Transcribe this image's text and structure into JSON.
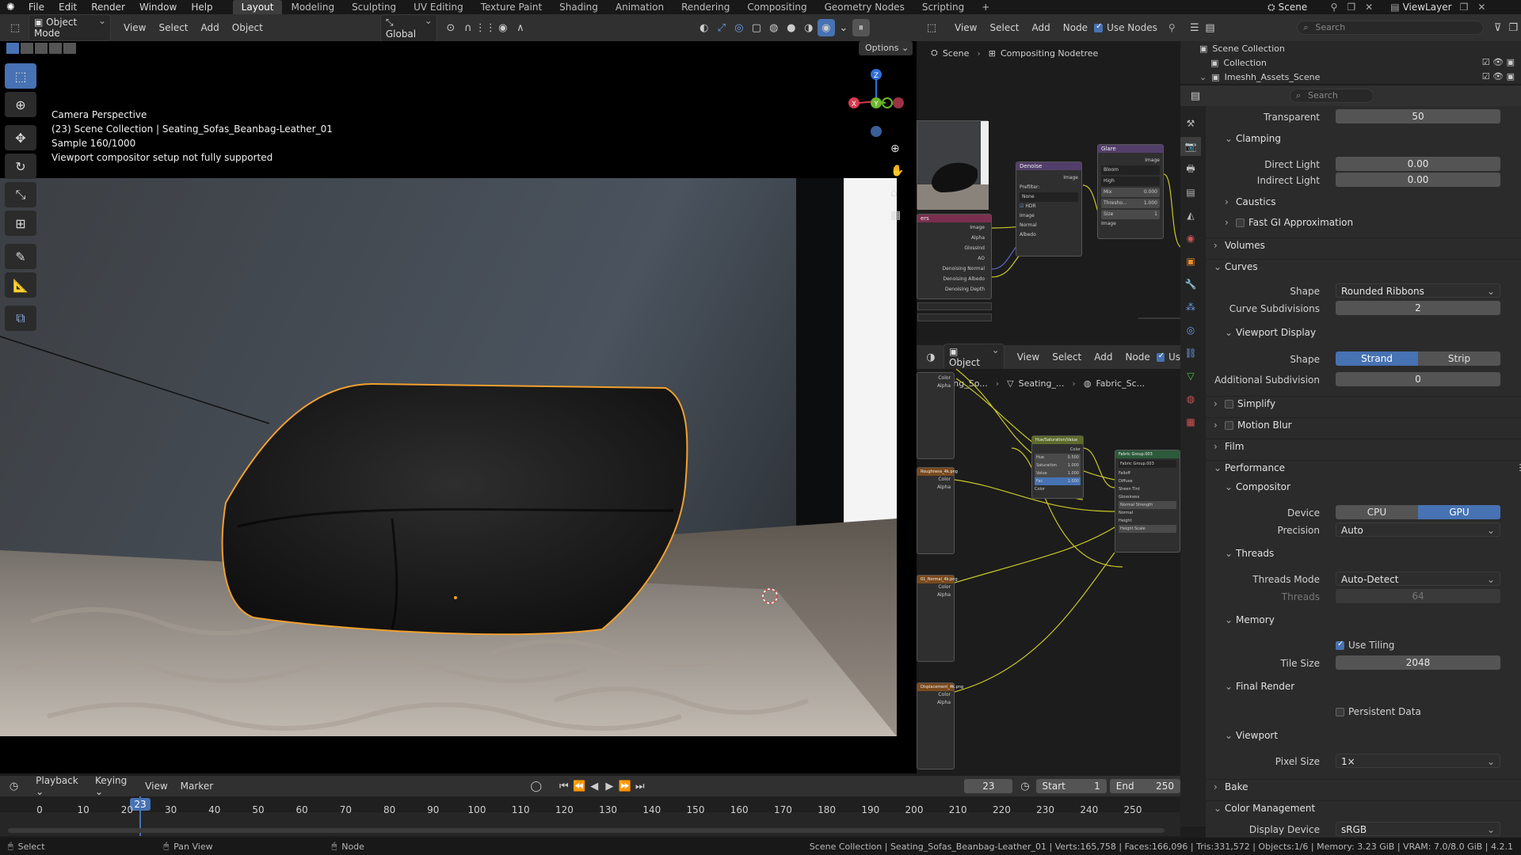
{
  "menu": [
    "File",
    "Edit",
    "Render",
    "Window",
    "Help"
  ],
  "workspaces": [
    "Layout",
    "Modeling",
    "Sculpting",
    "UV Editing",
    "Texture Paint",
    "Shading",
    "Animation",
    "Rendering",
    "Compositing",
    "Geometry Nodes",
    "Scripting"
  ],
  "active_workspace": "Layout",
  "scene_name": "Scene",
  "view_layer": "ViewLayer",
  "viewport": {
    "mode": "Object Mode",
    "menus": [
      "View",
      "Select",
      "Add",
      "Object"
    ],
    "transform_orientation": "Global",
    "options_label": "Options",
    "overlay_lines": [
      "Camera Perspective",
      "(23) Scene Collection | Seating_Sofas_Beanbag-Leather_01",
      "Sample 160/1000",
      "Viewport compositor setup not fully supported"
    ],
    "gizmo_axes": [
      "Z",
      "X",
      "Y"
    ]
  },
  "compositor": {
    "menus": [
      "View",
      "Select",
      "Add",
      "Node"
    ],
    "use_nodes_label": "Use Nodes",
    "breadcrumb": [
      "Scene",
      "Compositing Nodetree"
    ],
    "nodes": {
      "denoise": {
        "title": "Denoise",
        "output": "Image",
        "prefilter_label": "Prefilter:",
        "prefilter": "None",
        "hdr": "HDR",
        "inputs": [
          "Image",
          "Normal",
          "Albedo"
        ]
      },
      "glare": {
        "title": "Glare",
        "output": "Image",
        "type": "Bloom",
        "quality": "High",
        "mix": "Mix",
        "mix_val": "0.000",
        "threshold": "Thresho...",
        "threshold_val": "1.000",
        "size": "Size",
        "size_val": "1",
        "input": "Image"
      },
      "render_layers": {
        "title": "ers",
        "outputs": [
          "Image",
          "Alpha",
          "GlossInd",
          "AO",
          "Denoising Normal",
          "Denoising Albedo",
          "Denoising Depth"
        ]
      }
    }
  },
  "shader_editor": {
    "type": "Object",
    "menus": [
      "View",
      "Select",
      "Add",
      "Node"
    ],
    "use_label": "Us",
    "breadcrumb": [
      "Seating_So...",
      "Seating_...",
      "Fabric_Sc..."
    ],
    "nodes": {
      "hsv": {
        "title": "Hue/Saturation/Value",
        "output": "Color",
        "rows": [
          "Hue",
          "Saturation",
          "Value",
          "Fac"
        ],
        "values": [
          "0.500",
          "1.000",
          "1.000",
          "1.000"
        ],
        "input": "Color"
      },
      "group": {
        "title": "Fabric Group.003",
        "sub": "Fabric Group.003",
        "rows": [
          "Falloff",
          "Diffuse",
          "Sheen Tint",
          "Glossiness",
          "Normal Strength",
          "Normal",
          "Height",
          "Height Scale"
        ]
      },
      "tex1": {
        "label": "Roughness_4k.png",
        "outs": [
          "Color",
          "Alpha"
        ]
      },
      "tex2": {
        "label": "01_Normal_4k.png",
        "outs": [
          "Color",
          "Alpha"
        ]
      },
      "tex3": {
        "label": "Displacement_4k.png",
        "outs": [
          "Color",
          "Alpha"
        ]
      },
      "tex0": {
        "outs": [
          "Color",
          "Alpha"
        ]
      }
    }
  },
  "outliner": {
    "search_placeholder": "Search",
    "items": [
      "Scene Collection",
      "Collection",
      "Imeshh_Assets_Scene"
    ]
  },
  "properties": {
    "search_placeholder": "Search",
    "transparent": {
      "label": "Transparent",
      "value": "50"
    },
    "clamping": {
      "label": "Clamping",
      "direct": "Direct Light",
      "direct_val": "0.00",
      "indirect": "Indirect Light",
      "indirect_val": "0.00"
    },
    "caustics": "Caustics",
    "fast_gi": "Fast GI Approximation",
    "volumes": "Volumes",
    "curves": {
      "label": "Curves",
      "shape_label": "Shape",
      "shape": "Rounded Ribbons",
      "subdiv_label": "Curve Subdivisions",
      "subdiv": "2"
    },
    "viewport_display": {
      "label": "Viewport Display",
      "shape_label": "Shape",
      "strand": "Strand",
      "strip": "Strip",
      "add_subdiv_label": "Additional Subdivision",
      "add_subdiv": "0"
    },
    "simplify": "Simplify",
    "motion_blur": "Motion Blur",
    "film": "Film",
    "performance": "Performance",
    "compositor": {
      "label": "Compositor",
      "device_label": "Device",
      "cpu": "CPU",
      "gpu": "GPU",
      "precision_label": "Precision",
      "precision": "Auto"
    },
    "threads": {
      "label": "Threads",
      "mode_label": "Threads Mode",
      "mode": "Auto-Detect",
      "count_label": "Threads",
      "count": "64"
    },
    "memory": {
      "label": "Memory",
      "tiling": "Use Tiling",
      "tile_label": "Tile Size",
      "tile": "2048"
    },
    "final_render": {
      "label": "Final Render",
      "persistent": "Persistent Data"
    },
    "viewport": {
      "label": "Viewport",
      "pixel_label": "Pixel Size",
      "pixel": "1×"
    },
    "bake": "Bake",
    "color_management": {
      "label": "Color Management",
      "display_label": "Display Device",
      "display": "sRGB"
    }
  },
  "timeline": {
    "menus": [
      "Playback",
      "Keying",
      "View",
      "Marker"
    ],
    "current_frame": "23",
    "start_label": "Start",
    "start": "1",
    "end_label": "End",
    "end": "250",
    "ticks": [
      "0",
      "10",
      "20",
      "30",
      "40",
      "50",
      "60",
      "70",
      "80",
      "90",
      "100",
      "110",
      "120",
      "130",
      "140",
      "150",
      "160",
      "170",
      "180",
      "190",
      "200",
      "210",
      "220",
      "230",
      "240",
      "250"
    ]
  },
  "status": {
    "select": "Select",
    "pan": "Pan View",
    "node": "Node",
    "info": "Scene Collection | Seating_Sofas_Beanbag-Leather_01 | Verts:165,758 | Faces:166,096 | Tris:331,572 | Objects:1/6 | Memory: 3.23 GiB | VRAM: 7.0/8.0 GiB | 4.2.1"
  },
  "colors": {
    "accent": "#4772b3",
    "selection": "#f0a030",
    "header": "#303030"
  }
}
